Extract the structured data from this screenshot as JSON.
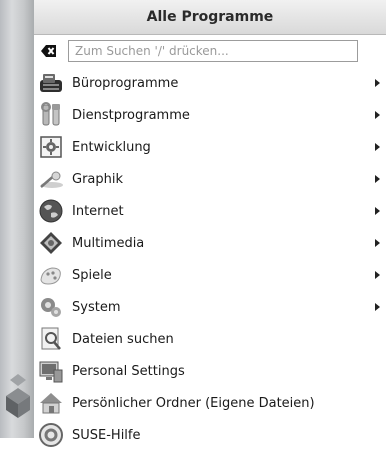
{
  "menu": {
    "title": "Alle Programme",
    "search": {
      "placeholder": "Zum Suchen '/' drücken...",
      "value": "",
      "clear_icon": "clear-search-icon"
    },
    "items": [
      {
        "label": "Büroprogramme",
        "icon": "office-icon",
        "submenu": true
      },
      {
        "label": "Dienstprogramme",
        "icon": "utilities-icon",
        "submenu": true
      },
      {
        "label": "Entwicklung",
        "icon": "development-icon",
        "submenu": true
      },
      {
        "label": "Graphik",
        "icon": "graphics-icon",
        "submenu": true
      },
      {
        "label": "Internet",
        "icon": "internet-icon",
        "submenu": true
      },
      {
        "label": "Multimedia",
        "icon": "multimedia-icon",
        "submenu": true
      },
      {
        "label": "Spiele",
        "icon": "games-icon",
        "submenu": true
      },
      {
        "label": "System",
        "icon": "system-icon",
        "submenu": true
      },
      {
        "label": "Dateien suchen",
        "icon": "find-files-icon",
        "submenu": false
      },
      {
        "label": "Personal Settings",
        "icon": "settings-icon",
        "submenu": false
      },
      {
        "label": "Persönlicher Ordner (Eigene Dateien)",
        "icon": "home-folder-icon",
        "submenu": false
      },
      {
        "label": "SUSE-Hilfe",
        "icon": "help-icon",
        "submenu": false
      }
    ]
  },
  "colors": {
    "header_bg": "#e2e2e2",
    "sidebar_bg": "#c6c8ca",
    "text": "#1a1a1a"
  }
}
